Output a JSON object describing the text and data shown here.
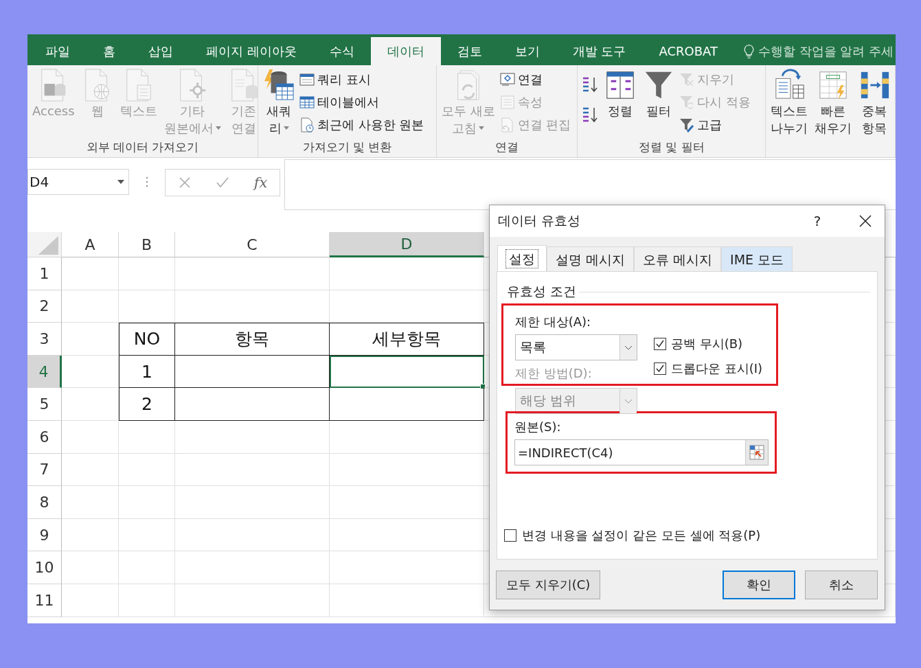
{
  "tabs": [
    {
      "label": "파일",
      "selected": false
    },
    {
      "label": "홈",
      "selected": false
    },
    {
      "label": "삽입",
      "selected": false
    },
    {
      "label": "페이지 레이아웃",
      "selected": false
    },
    {
      "label": "수식",
      "selected": false
    },
    {
      "label": "데이터",
      "selected": true
    },
    {
      "label": "검토",
      "selected": false
    },
    {
      "label": "보기",
      "selected": false
    },
    {
      "label": "개발 도구",
      "selected": false
    },
    {
      "label": "ACROBAT",
      "selected": false
    }
  ],
  "tell_me": {
    "placeholder": "수행할 작업을 알려 주세"
  },
  "ribbon": {
    "groups": [
      {
        "label": "외부 데이터 가져오기",
        "items": [
          {
            "kind": "large",
            "lines": [
              "Access"
            ],
            "disabled": true,
            "dropdown": false
          },
          {
            "kind": "large",
            "lines": [
              "웹"
            ],
            "disabled": true,
            "dropdown": false
          },
          {
            "kind": "large",
            "lines": [
              "텍스트"
            ],
            "disabled": true,
            "dropdown": false
          },
          {
            "kind": "large",
            "lines": [
              "기타",
              "원본에서"
            ],
            "disabled": true,
            "dropdown": true
          },
          {
            "kind": "large",
            "lines": [
              "기존",
              "연결"
            ],
            "disabled": true,
            "dropdown": false
          }
        ]
      },
      {
        "label": "가져오기 및 변환",
        "items": [
          {
            "kind": "large",
            "lines": [
              "새쿼",
              "리"
            ],
            "disabled": false,
            "dropdown": true
          },
          {
            "kind": "stack",
            "items": [
              {
                "label": "쿼리 표시",
                "disabled": false
              },
              {
                "label": "테이블에서",
                "disabled": false
              },
              {
                "label": "최근에 사용한 원본",
                "disabled": false
              }
            ]
          }
        ]
      },
      {
        "label": "연결",
        "items": [
          {
            "kind": "large",
            "lines": [
              "모두 새로",
              "고침"
            ],
            "disabled": true,
            "dropdown": true
          },
          {
            "kind": "stack",
            "items": [
              {
                "label": "연결",
                "disabled": false
              },
              {
                "label": "속성",
                "disabled": true
              },
              {
                "label": "연결 편집",
                "disabled": true
              }
            ]
          }
        ]
      },
      {
        "label": "정렬 및 필터",
        "items": [
          {
            "kind": "sort"
          },
          {
            "kind": "large",
            "lines": [
              "정렬"
            ],
            "disabled": false,
            "dropdown": false
          },
          {
            "kind": "large",
            "lines": [
              "필터"
            ],
            "disabled": false,
            "dropdown": false
          },
          {
            "kind": "stack",
            "items": [
              {
                "label": "지우기",
                "disabled": true
              },
              {
                "label": "다시 적용",
                "disabled": true
              },
              {
                "label": "고급",
                "disabled": false
              }
            ]
          }
        ]
      },
      {
        "items": [
          {
            "kind": "large",
            "lines": [
              "텍스트",
              "나누기"
            ],
            "disabled": false,
            "dropdown": false
          },
          {
            "kind": "large",
            "lines": [
              "빠른",
              "채우기"
            ],
            "disabled": false,
            "dropdown": false
          },
          {
            "kind": "large",
            "lines": [
              "중복",
              "항목"
            ],
            "disabled": false,
            "dropdown": false
          }
        ]
      }
    ]
  },
  "formula_bar": {
    "name_box": "D4",
    "function_label": "fx"
  },
  "sheet": {
    "columns": [
      {
        "label": "A",
        "selected": false
      },
      {
        "label": "B",
        "selected": false
      },
      {
        "label": "C",
        "selected": false
      },
      {
        "label": "D",
        "selected": true
      }
    ],
    "rows": [
      {
        "label": "1",
        "selected": false
      },
      {
        "label": "2",
        "selected": false
      },
      {
        "label": "3",
        "selected": false
      },
      {
        "label": "4",
        "selected": true
      },
      {
        "label": "5",
        "selected": false
      },
      {
        "label": "6",
        "selected": false
      },
      {
        "label": "7",
        "selected": false
      },
      {
        "label": "8",
        "selected": false
      },
      {
        "label": "9",
        "selected": false
      },
      {
        "label": "10",
        "selected": false
      },
      {
        "label": "11",
        "selected": false
      }
    ],
    "table": {
      "headers": [
        "NO",
        "항목",
        "세부항목"
      ],
      "rows": [
        {
          "no": "1"
        },
        {
          "no": "2"
        }
      ]
    }
  },
  "dialog": {
    "title": "데이터 유효성",
    "help": "?",
    "tabs": [
      {
        "label": "설정",
        "selected": true,
        "hovered": false
      },
      {
        "label": "설명 메시지",
        "selected": false,
        "hovered": false
      },
      {
        "label": "오류 메시지",
        "selected": false,
        "hovered": false
      },
      {
        "label": "IME 모드",
        "selected": false,
        "hovered": true
      }
    ],
    "group_label": "유효성 조건",
    "allow": {
      "label": "제한 대상(A):",
      "value": "목록",
      "highlighted": true
    },
    "options": [
      {
        "label": "공백 무시(B)",
        "checked": true
      },
      {
        "label": "드롭다운 표시(I)",
        "checked": true
      }
    ],
    "data": {
      "label": "제한 방법(D):",
      "value": "해당 범위",
      "disabled": true
    },
    "source": {
      "label": "원본(S):",
      "value": "=INDIRECT(C4)",
      "highlighted": true
    },
    "apply_all": {
      "label": "변경 내용을 설정이 같은 모든 셀에 적용(P)",
      "checked": false
    },
    "buttons": [
      {
        "label": "모두 지우기(C)",
        "default": false
      },
      {
        "label": "확인",
        "default": true
      },
      {
        "label": "취소",
        "default": false
      }
    ]
  }
}
